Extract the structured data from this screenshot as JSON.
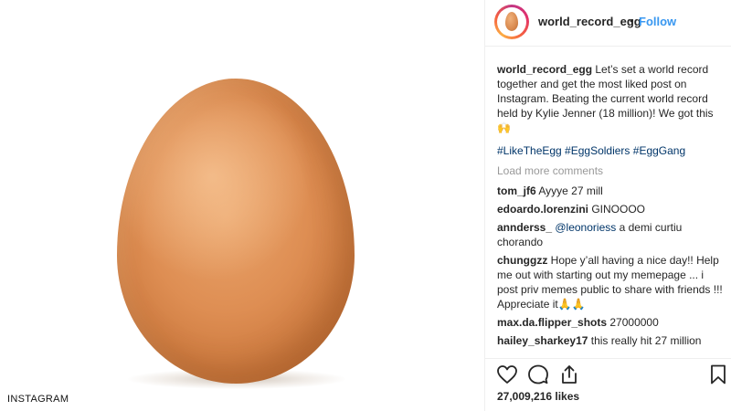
{
  "post": {
    "username": "world_record_egg",
    "separator": "•",
    "follow_label": "Follow",
    "watermark": "INSTAGRAM"
  },
  "caption": {
    "username": "world_record_egg",
    "text": " Let’s set a world record together and get the most liked post on Instagram. Beating the current world record held by Kylie Jenner (18 million)! We got this 🙌",
    "hashtags": "#LikeTheEgg #EggSoldiers #EggGang"
  },
  "load_more_label": "Load more comments",
  "comments": [
    {
      "username": "tom_jf6",
      "text": " Ayyye 27 mill"
    },
    {
      "username": "edoardo.lorenzini",
      "text": " GINOOOO"
    },
    {
      "username": "annderss_",
      "mention": " @leonoriess",
      "text": " a demi curtiu chorando"
    },
    {
      "username": "chunggzz",
      "text": " Hope y’all having a nice day!! Help me out with starting out my memepage ... i post priv memes public to share with friends !!! Appreciate it🙏🙏"
    },
    {
      "username": "max.da.flipper_shots",
      "text": " 27000000"
    },
    {
      "username": "hailey_sharkey17",
      "text": " this really hit 27 million"
    }
  ],
  "actions": {
    "like_icon": "heart-icon",
    "comment_icon": "comment-icon",
    "share_icon": "share-icon",
    "save_icon": "bookmark-icon"
  },
  "likes_label": "27,009,216 likes",
  "colors": {
    "link_blue": "#3897f0",
    "hashtag": "#003569",
    "muted": "#999999",
    "egg": "#de8e53"
  }
}
